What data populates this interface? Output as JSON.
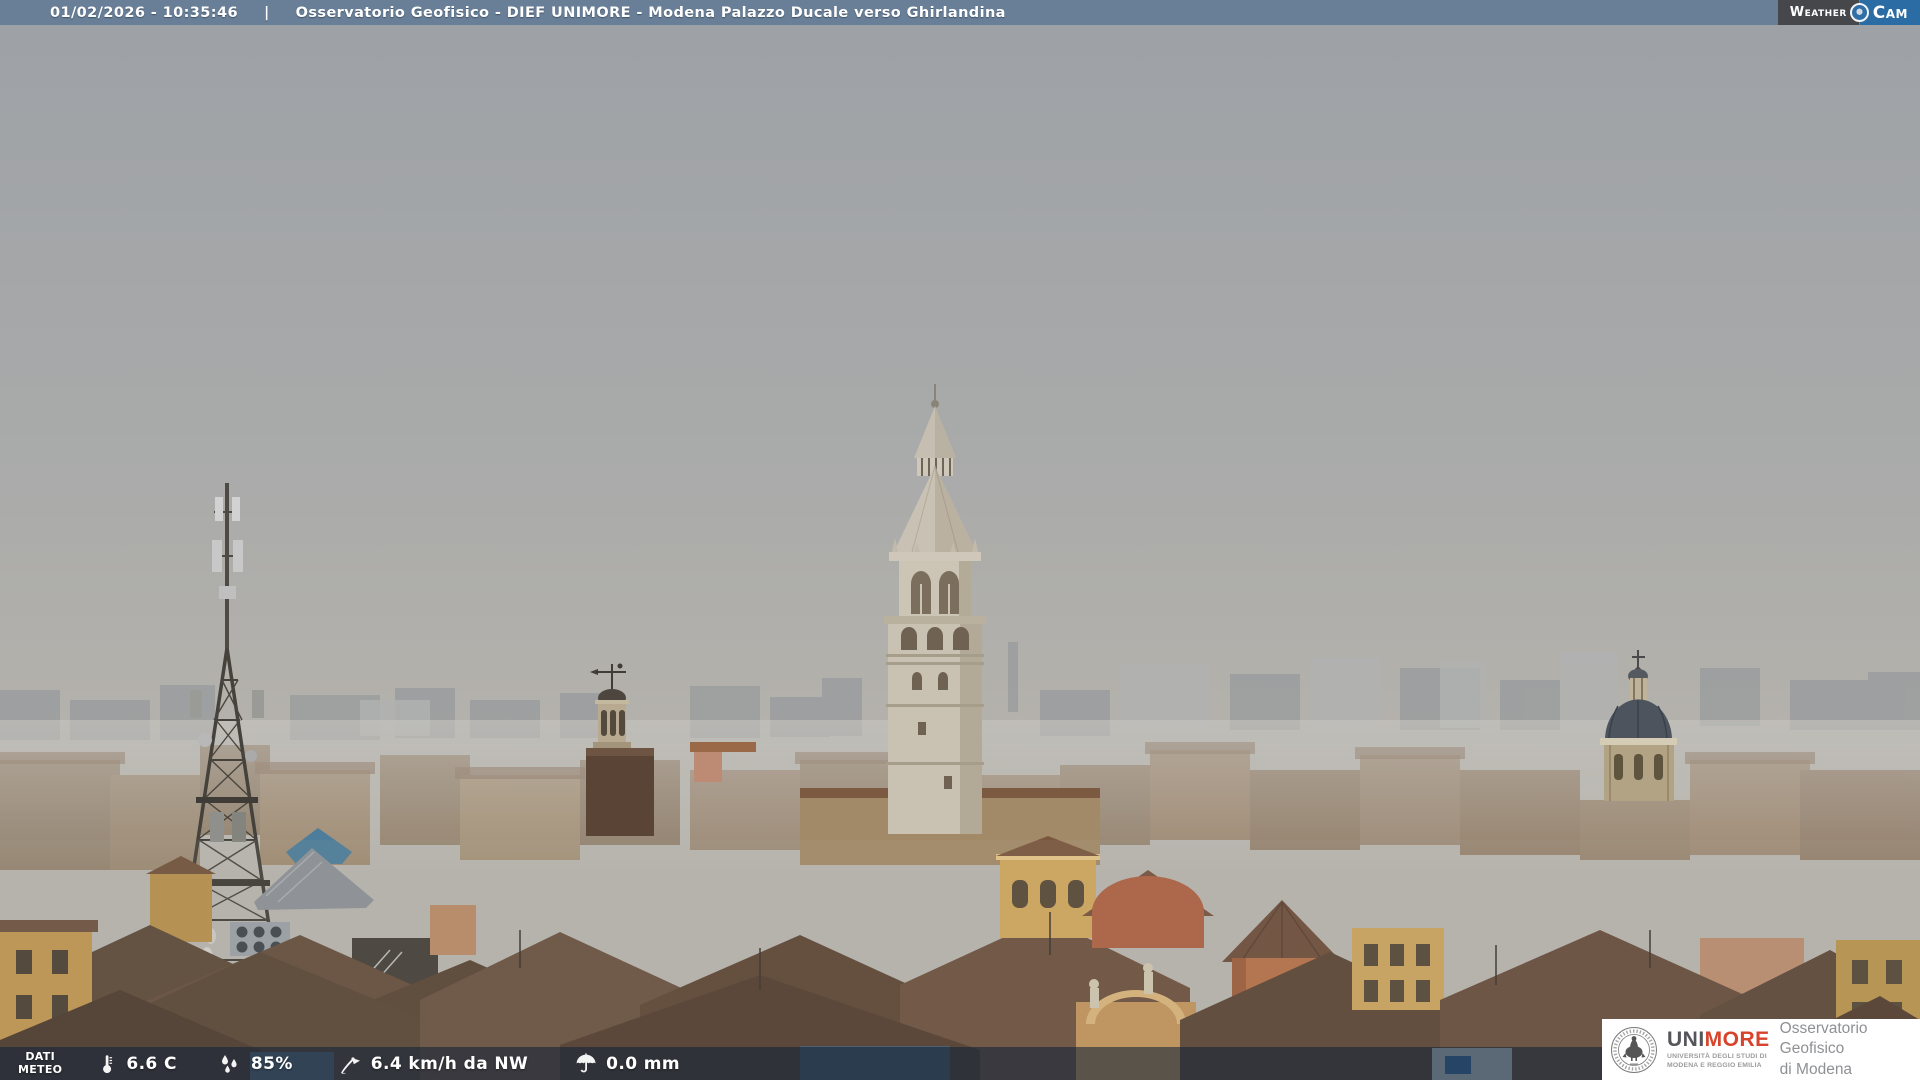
{
  "header": {
    "timestamp": "01/02/2026 - 10:35:46",
    "separator": "|",
    "title": "Osservatorio Geofisico - DIEF UNIMORE - Modena Palazzo Ducale verso Ghirlandina"
  },
  "weathercam": {
    "weather": "Weather",
    "cam": "Cam"
  },
  "weather_bar": {
    "label_line1": "DATI",
    "label_line2": "METEO",
    "items": [
      {
        "icon": "thermometer-icon",
        "value": "6.6 C"
      },
      {
        "icon": "humidity-icon",
        "value": "85%"
      },
      {
        "icon": "wind-icon",
        "value": "6.4 km/h da NW"
      },
      {
        "icon": "rain-icon",
        "value": "0.0 mm"
      }
    ]
  },
  "unimore": {
    "brand_uni": "UNI",
    "brand_more": "MORE",
    "subtitle_line1": "UNIVERSITÀ DEGLI STUDI DI",
    "subtitle_line2": "MODENA E REGGIO EMILIA",
    "org_line1": "Osservatorio Geofisico",
    "org_line2": "di Modena"
  },
  "colors": {
    "header_bar": "#697f97",
    "weathercam_blue": "#2a6ca3",
    "weathercam_dark": "#45474b",
    "overlay_bar": "rgba(17,35,56,0.58)",
    "brand_red": "#d8432c",
    "sky_top": "#9da1a6",
    "sky_horizon": "#b7b4ae"
  }
}
